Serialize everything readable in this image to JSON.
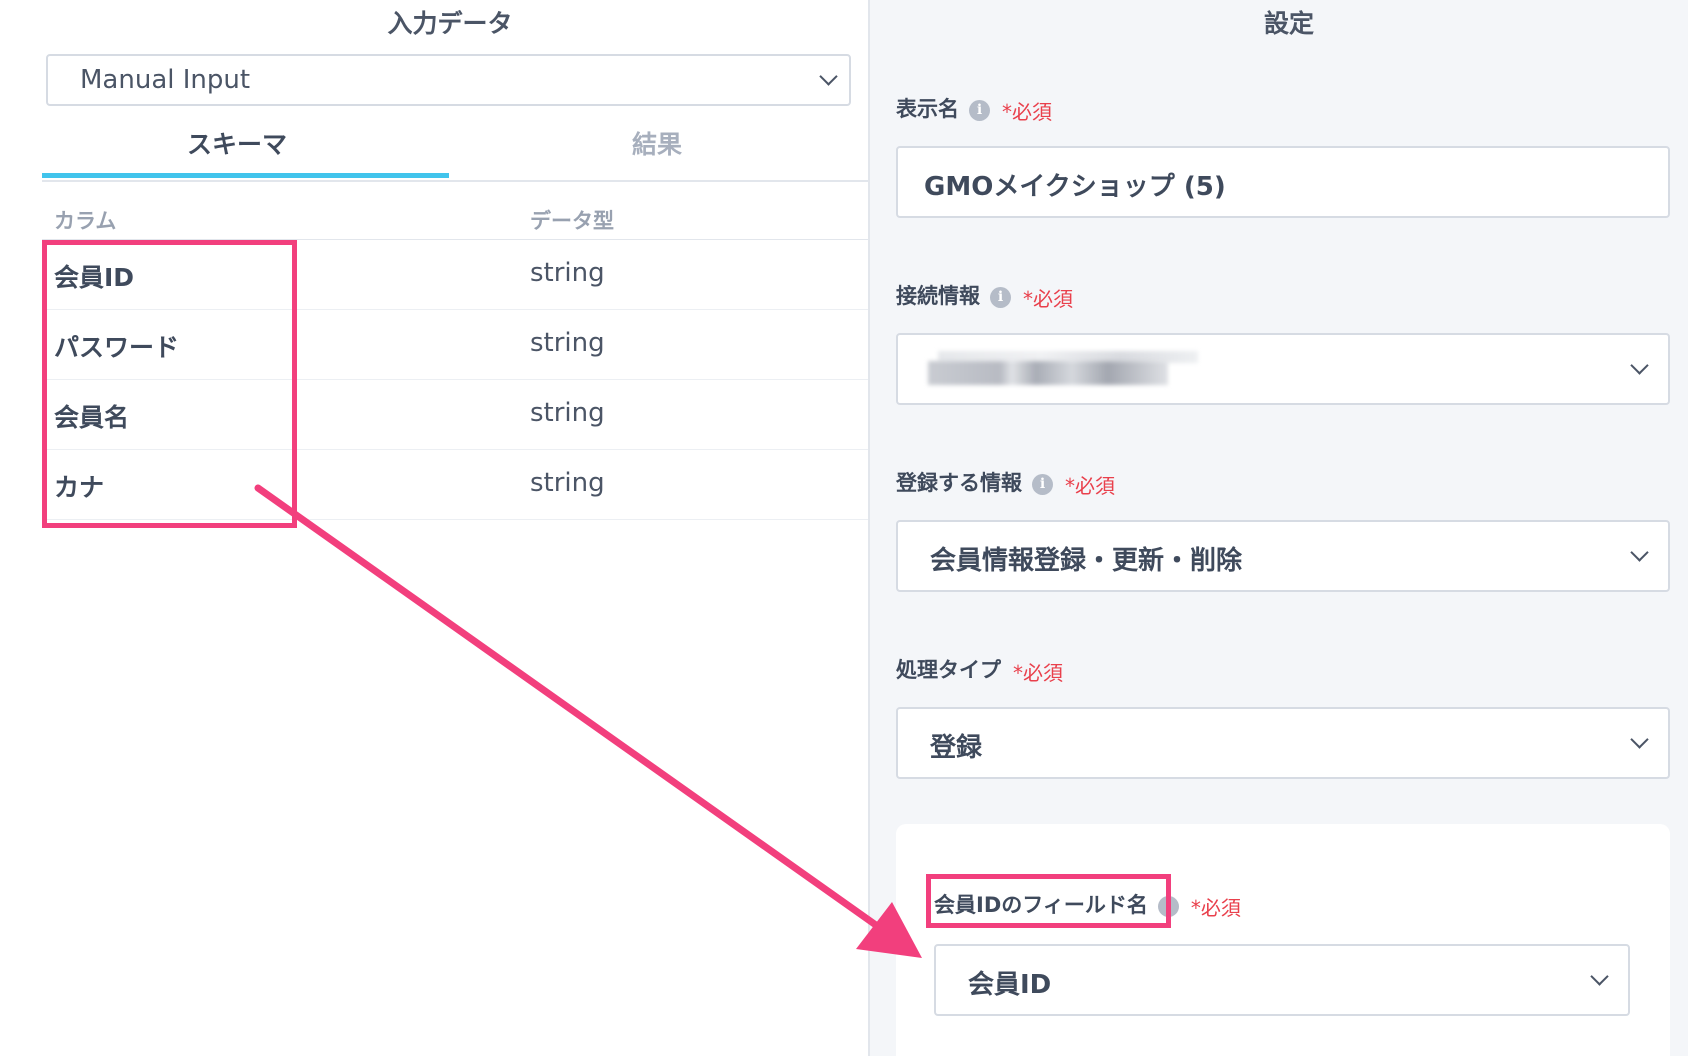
{
  "left_panel": {
    "title": "入力データ",
    "source_select": {
      "value": "Manual Input"
    },
    "tabs": [
      {
        "label": "スキーマ",
        "active": true
      },
      {
        "label": "結果",
        "active": false
      }
    ],
    "columns_header": {
      "name": "カラム",
      "type": "データ型"
    },
    "rows": [
      {
        "name": "会員ID",
        "type": "string"
      },
      {
        "name": "パスワード",
        "type": "string"
      },
      {
        "name": "会員名",
        "type": "string"
      },
      {
        "name": "カナ",
        "type": "string"
      }
    ]
  },
  "right_panel": {
    "title": "設定",
    "required_label": "*必須",
    "info_icon": "i",
    "fields": {
      "display_name": {
        "label": "表示名",
        "value": "GMOメイクショップ (5)"
      },
      "connection": {
        "label": "接続情報",
        "value": ""
      },
      "register_info": {
        "label": "登録する情報",
        "value": "会員情報登録・更新・削除"
      },
      "process_type": {
        "label": "処理タイプ",
        "value": "登録"
      },
      "member_id_field": {
        "label": "会員IDのフィールド名",
        "value": "会員ID"
      }
    }
  },
  "annotation_color": "#f23f7d",
  "accent_color": "#41c4ec",
  "required_color": "#e9404c"
}
